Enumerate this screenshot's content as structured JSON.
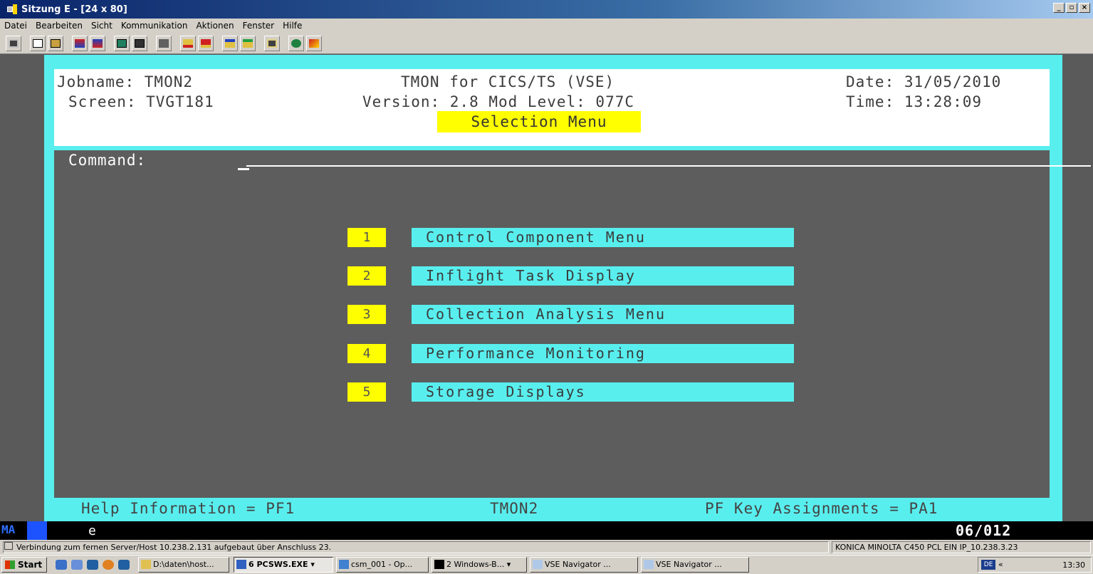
{
  "window": {
    "title": "Sitzung E - [24 x 80]",
    "buttons": {
      "minimize": "_",
      "maximize": "▫",
      "close": "×"
    }
  },
  "menubar": {
    "items": [
      "Datei",
      "Bearbeiten",
      "Sicht",
      "Kommunikation",
      "Aktionen",
      "Fenster",
      "Hilfe"
    ]
  },
  "terminal": {
    "header": {
      "jobname": "Jobname: TMON2",
      "product": "TMON for CICS/TS (VSE)",
      "date": "Date: 31/05/2010",
      "screen": "Screen: TVGT181",
      "version": "Version: 2.8 Mod Level: 077C",
      "time": "Time: 13:28:09",
      "menu_title": "Selection Menu"
    },
    "command": {
      "label": "Command:",
      "value": ""
    },
    "options": [
      {
        "number": "1",
        "label": "Control Component Menu"
      },
      {
        "number": "2",
        "label": "Inflight Task Display"
      },
      {
        "number": "3",
        "label": "Collection Analysis Menu"
      },
      {
        "number": "4",
        "label": "Performance Monitoring"
      },
      {
        "number": "5",
        "label": "Storage Displays"
      }
    ],
    "footer": {
      "help": "Help Information = PF1",
      "job": "TMON2",
      "pfkeys": "PF Key Assignments = PA1"
    },
    "colors": {
      "frame": "#59eeee",
      "highlight": "#ffff00",
      "screen_bg": "#5d5d5d"
    }
  },
  "oia": {
    "mode": "MA",
    "session": "e",
    "cursor_position": "06/012"
  },
  "connection": {
    "message": "Verbindung zum fernen Server/Host 10.238.2.131 aufgebaut über Anschluss 23.",
    "printer": "KONICA MINOLTA C450 PCL EIN IP_10.238.3.23"
  },
  "taskbar": {
    "start": "Start",
    "tasks": [
      "D:\\daten\\host...",
      "6 PCSWS.EXE",
      "csm_001 - Op...",
      "2 Windows-B...",
      "VSE Navigator ...",
      "VSE Navigator ..."
    ],
    "language": "DE",
    "arrows": "«",
    "clock": "13:30"
  }
}
